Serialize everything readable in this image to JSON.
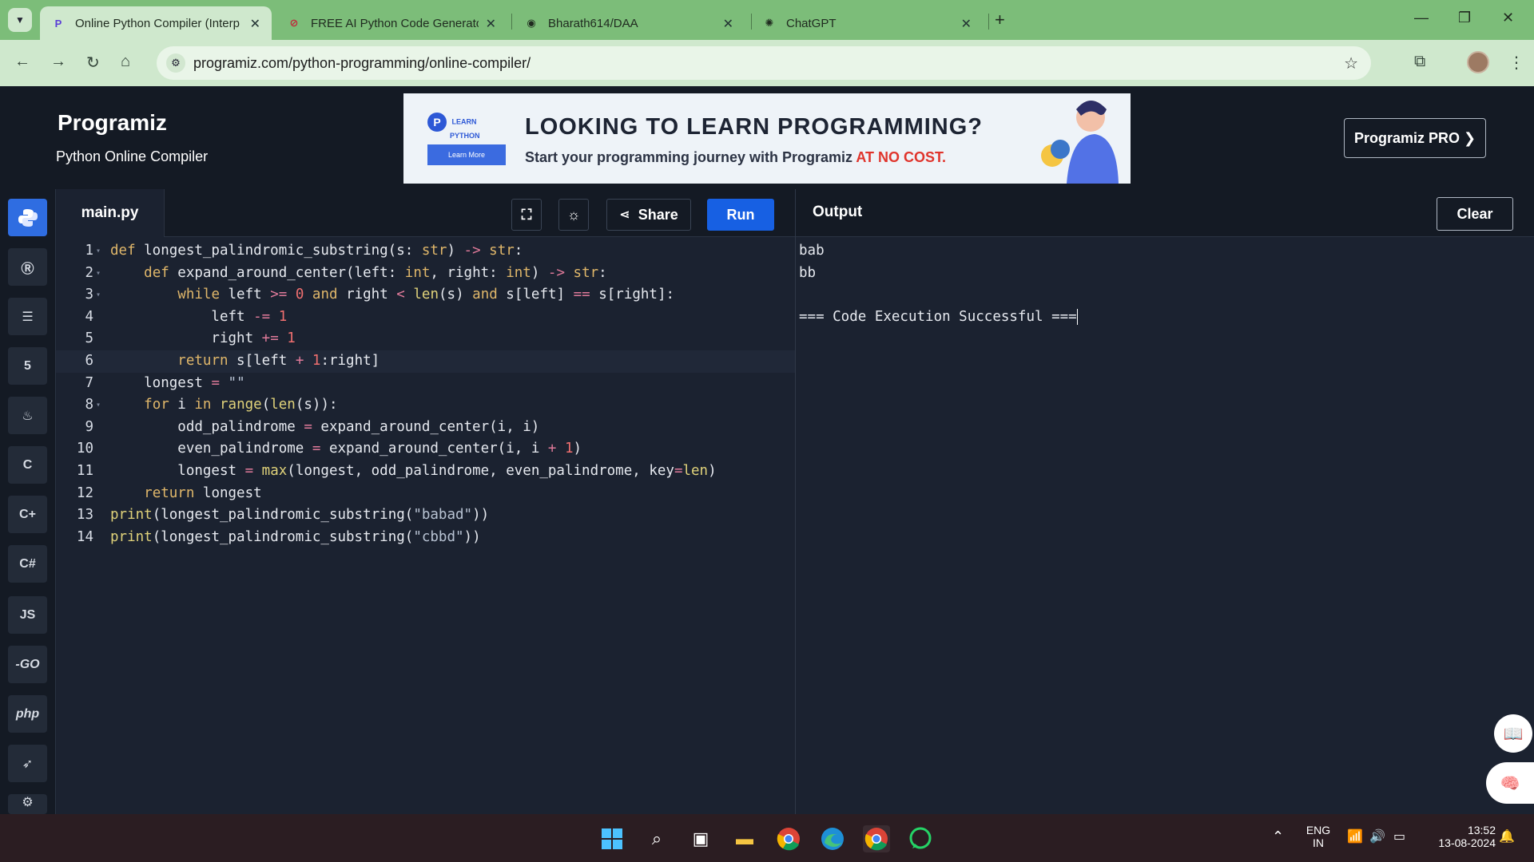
{
  "browser": {
    "tabs": [
      {
        "title": "Online Python Compiler (Interp",
        "favicon": "programiz-icon",
        "active": true
      },
      {
        "title": "FREE AI Python Code Generator",
        "favicon": "codeconvert-icon",
        "active": false
      },
      {
        "title": "Bharath614/DAA",
        "favicon": "github-icon",
        "active": false
      },
      {
        "title": "ChatGPT",
        "favicon": "chatgpt-icon",
        "active": false
      }
    ],
    "url": "programiz.com/python-programming/online-compiler/"
  },
  "header": {
    "logo": "Programiz",
    "subtitle": "Python Online Compiler",
    "pro_button": "Programiz PRO ❯",
    "banner": {
      "brand_line1": "LEARN",
      "brand_line2": "PYTHON",
      "button": "Learn More",
      "headline": "LOOKING TO LEARN PROGRAMMING?",
      "subline": "Start your programming journey with Programiz ",
      "highlight": "AT NO COST."
    }
  },
  "sidebar": {
    "languages": [
      "python-icon",
      "r-icon",
      "sql-icon",
      "html-icon",
      "java-icon",
      "c-icon",
      "cpp-icon",
      "csharp-icon",
      "JS",
      "GO",
      "php",
      "swift-icon",
      "rust-icon"
    ],
    "labels": {
      "js": "JS",
      "go": "-GO",
      "php": "php"
    }
  },
  "editor": {
    "filename": "main.py",
    "share": "Share",
    "run": "Run",
    "line_numbers": [
      "1",
      "2",
      "3",
      "4",
      "5",
      "6",
      "7",
      "8",
      "9",
      "10",
      "11",
      "12",
      "13",
      "14"
    ]
  },
  "output": {
    "title": "Output",
    "clear": "Clear",
    "lines": [
      "bab",
      "bb",
      "",
      "=== Code Execution Successful ==="
    ]
  },
  "taskbar": {
    "lang_top": "ENG",
    "lang_bottom": "IN",
    "time": "13:52",
    "date": "13-08-2024"
  },
  "colors": {
    "accent": "#1760e3",
    "editor_bg": "#1b2230",
    "header_bg": "#141a24",
    "tab_strip": "#7cbd79"
  }
}
